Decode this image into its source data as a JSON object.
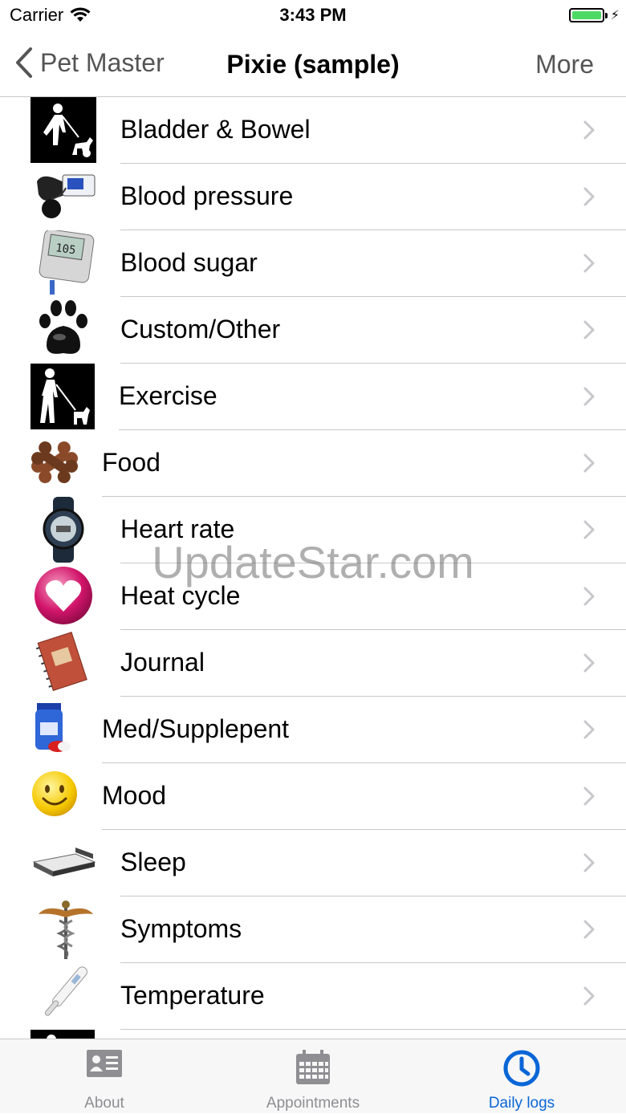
{
  "status": {
    "carrier": "Carrier",
    "time": "3:43 PM",
    "battery_level": 1.0
  },
  "nav": {
    "back_label": "Pet Master",
    "title": "Pixie (sample)",
    "more_label": "More"
  },
  "list": {
    "items": [
      {
        "label": "Bladder & Bowel",
        "icon": "dog-walker-icon"
      },
      {
        "label": "Blood pressure",
        "icon": "blood-pressure-monitor-icon"
      },
      {
        "label": "Blood sugar",
        "icon": "glucose-meter-icon"
      },
      {
        "label": "Custom/Other",
        "icon": "paw-print-icon"
      },
      {
        "label": "Exercise",
        "icon": "walking-dog-icon"
      },
      {
        "label": "Food",
        "icon": "dog-bone-icon"
      },
      {
        "label": "Heart rate",
        "icon": "heart-rate-watch-icon"
      },
      {
        "label": "Heat cycle",
        "icon": "heart-icon"
      },
      {
        "label": "Journal",
        "icon": "journal-book-icon"
      },
      {
        "label": "Med/Supplepent",
        "icon": "medicine-bottle-icon"
      },
      {
        "label": "Mood",
        "icon": "smiley-face-icon"
      },
      {
        "label": "Sleep",
        "icon": "bed-icon"
      },
      {
        "label": "Symptoms",
        "icon": "caduceus-icon"
      },
      {
        "label": "Temperature",
        "icon": "thermometer-icon"
      }
    ]
  },
  "watermark": "UpdateStar.com",
  "tabs": [
    {
      "label": "About",
      "icon": "id-card-icon",
      "active": false
    },
    {
      "label": "Appointments",
      "icon": "calendar-icon",
      "active": false
    },
    {
      "label": "Daily logs",
      "icon": "clock-icon",
      "active": true
    }
  ],
  "colors": {
    "accent": "#0a66d6",
    "inactive": "#8e8e93",
    "separator": "#c8c7cc",
    "battery": "#4cd964"
  }
}
